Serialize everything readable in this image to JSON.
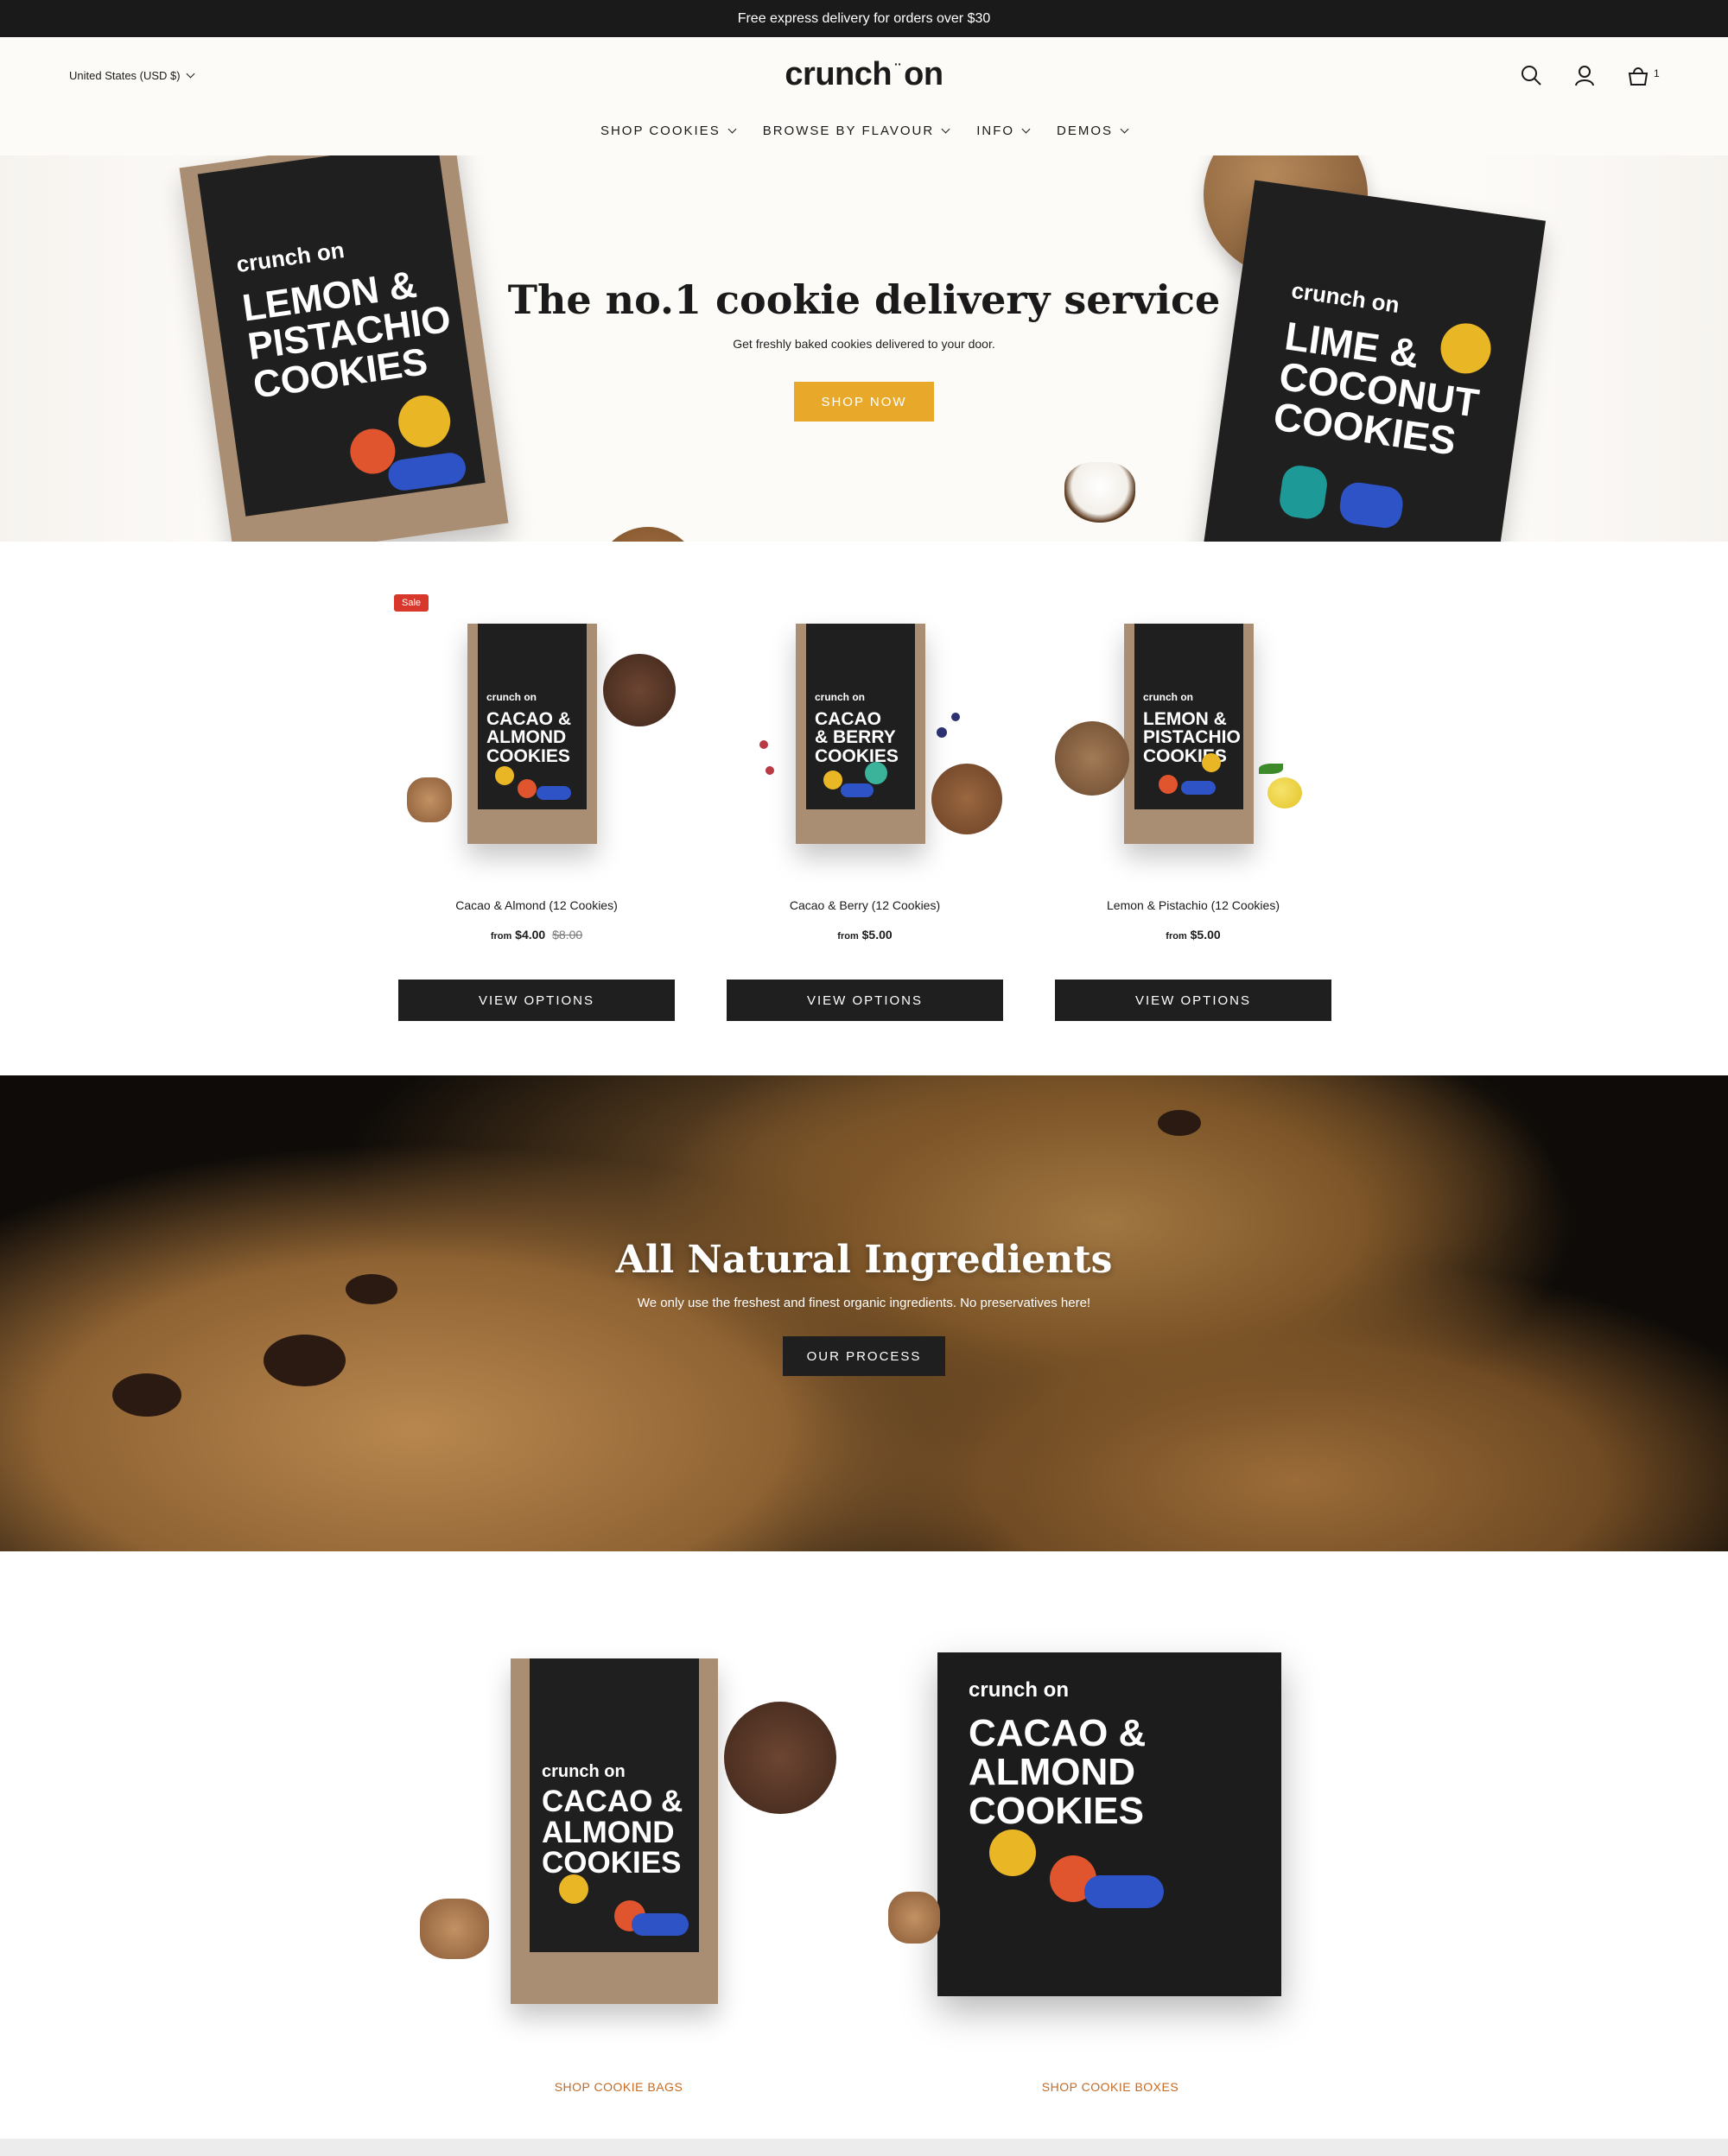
{
  "announcement": "Free express delivery for orders over $30",
  "header": {
    "currency": "United States (USD $)",
    "logo_left": "crunch",
    "logo_dots": "··",
    "logo_right": "on",
    "cart_count": "1",
    "nav": [
      "SHOP COOKIES",
      "BROWSE BY FLAVOUR",
      "INFO",
      "DEMOS"
    ]
  },
  "hero": {
    "title": "The no.1 cookie delivery service",
    "subtitle": "Get freshly baked cookies delivered to your door.",
    "button": "SHOP NOW",
    "bag_left": {
      "brand": "crunch on",
      "flavour": [
        "LEMON &",
        "PISTACHIO",
        "COOKIES"
      ]
    },
    "bag_right": {
      "brand": "crunch on",
      "flavour": [
        "LIME &",
        "COCONUT",
        "COOKIES"
      ]
    }
  },
  "products": [
    {
      "name": "Cacao & Almond (12 Cookies)",
      "from": "from",
      "price": "$4.00",
      "compare_price": "$8.00",
      "badge": "Sale",
      "button": "VIEW OPTIONS",
      "bag_brand": "crunch on",
      "bag_flavour": [
        "CACAO &",
        "ALMOND",
        "COOKIES"
      ]
    },
    {
      "name": "Cacao & Berry (12 Cookies)",
      "from": "from",
      "price": "$5.00",
      "button": "VIEW OPTIONS",
      "bag_brand": "crunch on",
      "bag_flavour": [
        "CACAO",
        "& BERRY",
        "COOKIES"
      ]
    },
    {
      "name": "Lemon & Pistachio (12 Cookies)",
      "from": "from",
      "price": "$5.00",
      "button": "VIEW OPTIONS",
      "bag_brand": "crunch on",
      "bag_flavour": [
        "LEMON &",
        "PISTACHIO",
        "COOKIES"
      ]
    }
  ],
  "banner": {
    "title": "All Natural Ingredients",
    "subtitle": "We only use the freshest and finest organic ingredients. No preservatives here!",
    "button": "OUR PROCESS"
  },
  "collections": {
    "bags_link": "SHOP COOKIE BAGS",
    "boxes_link": "SHOP COOKIE BOXES",
    "bag": {
      "brand": "crunch on",
      "flavour": [
        "CACAO &",
        "ALMOND",
        "COOKIES"
      ]
    },
    "box": {
      "brand": "crunch on",
      "flavour": [
        "CACAO &",
        "ALMOND",
        "COOKIES"
      ]
    }
  },
  "colors": {
    "accent": "#e8a92a",
    "dark": "#1f1f1f",
    "sale": "#d8382c",
    "link": "#c46a22"
  },
  "icons": [
    "search-icon",
    "account-icon",
    "cart-icon",
    "chevron-down-icon"
  ]
}
